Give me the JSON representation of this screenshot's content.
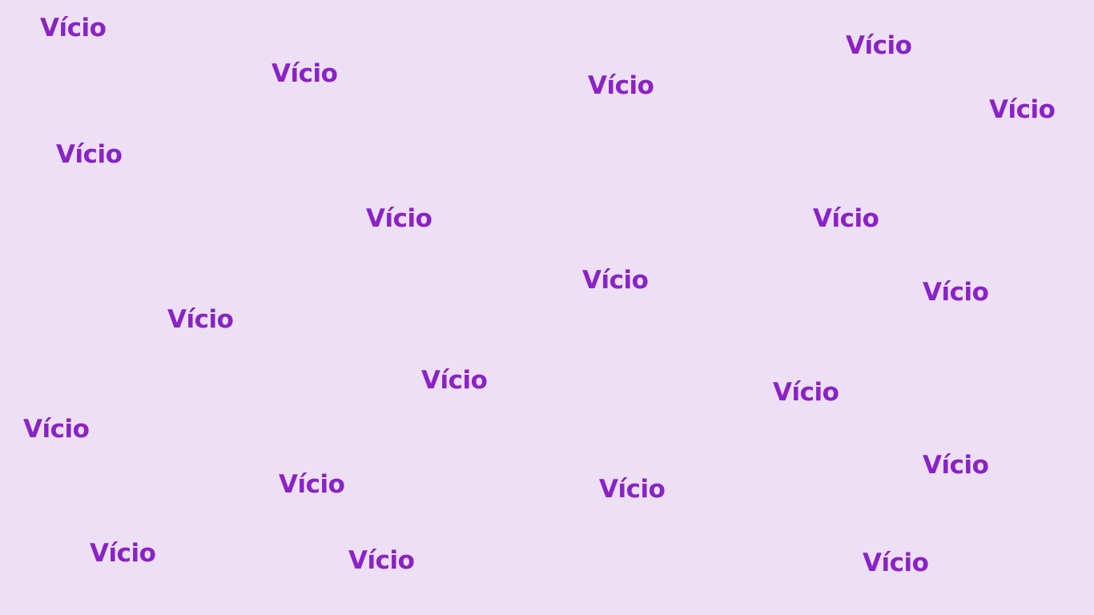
{
  "background": {
    "color": "#ede0f4",
    "logo_text": "Vício",
    "logo_color": "#8a22c8"
  }
}
